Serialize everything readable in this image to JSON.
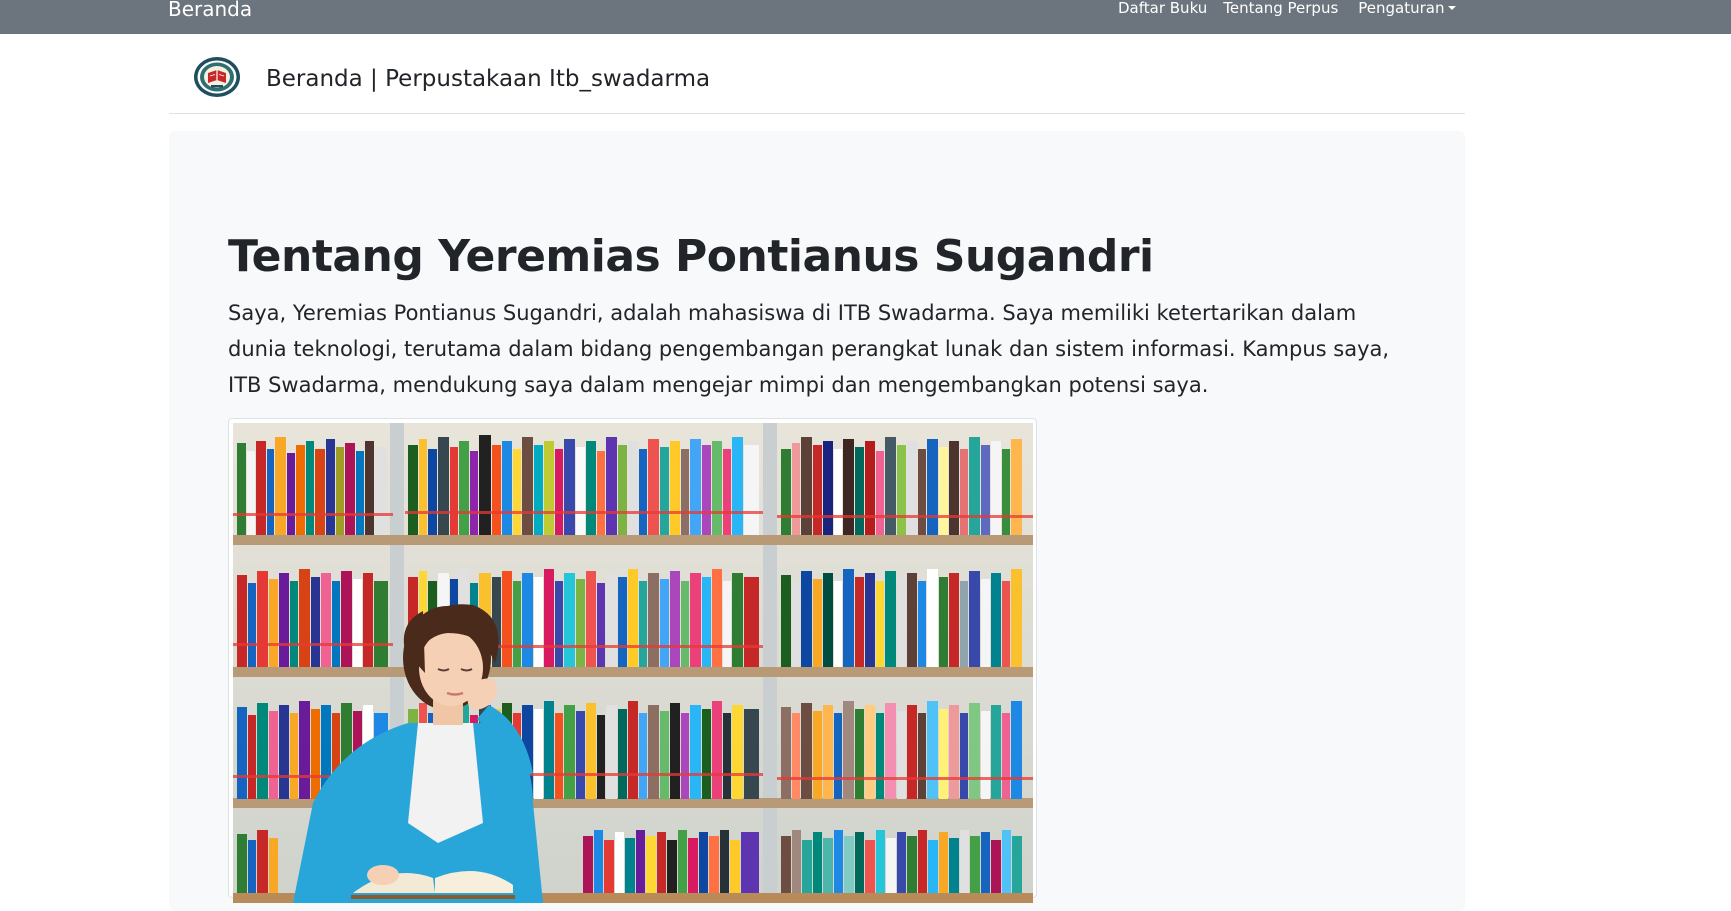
{
  "navbar": {
    "brand": "Beranda",
    "links": [
      "Daftar Buku",
      "Tentang Perpus",
      "Pengaturan"
    ]
  },
  "header": {
    "title": "Beranda | Perpustakaan Itb_swadarma"
  },
  "about": {
    "title": "Tentang Yeremias Pontianus Sugandri",
    "text": "Saya, Yeremias Pontianus Sugandri, adalah mahasiswa di ITB Swadarma. Saya memiliki ketertarikan dalam dunia teknologi, terutama dalam bidang pengembangan perangkat lunak dan sistem informasi. Kampus saya, ITB Swadarma, mendukung saya dalam mengejar mimpi dan mengembangkan potensi saya."
  },
  "colors": {
    "navbar_bg": "#6c757d",
    "jumbotron_bg": "#f8f9fa",
    "text": "#212529"
  },
  "icons": {
    "logo": "itbs-logo",
    "dropdown": "caret-down-icon"
  }
}
